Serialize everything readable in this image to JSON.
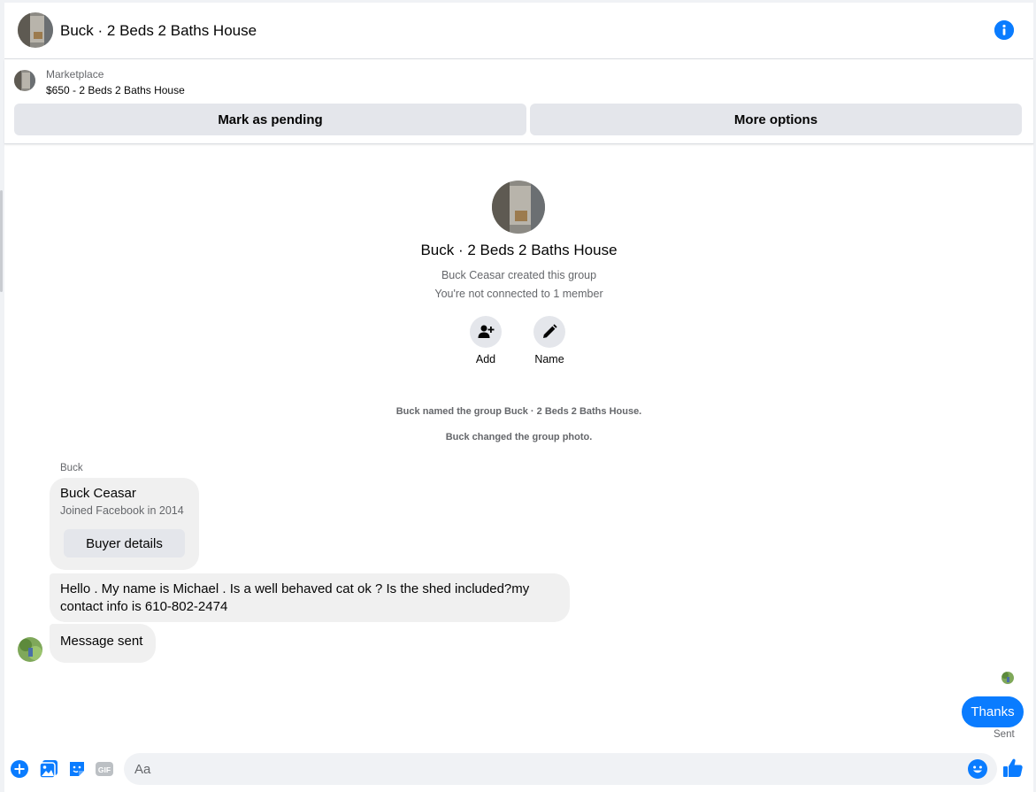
{
  "header": {
    "title": "Buck · 2 Beds 2 Baths House",
    "info_icon": "info-icon"
  },
  "marketplace": {
    "label": "Marketplace",
    "listing": "$650 - 2 Beds 2 Baths House",
    "pending_button": "Mark as pending",
    "more_button": "More options"
  },
  "group": {
    "title": "Buck · 2 Beds 2 Baths House",
    "created_by": "Buck Ceasar created this group",
    "connection": "You're not connected to 1 member",
    "actions": [
      {
        "label": "Add",
        "icon": "add-person-icon"
      },
      {
        "label": "Name",
        "icon": "pencil-icon"
      }
    ]
  },
  "system_messages": [
    "Buck named the group Buck · 2 Beds 2 Baths House.",
    "Buck changed the group photo."
  ],
  "conversation": {
    "sender_name": "Buck",
    "profile_card": {
      "name": "Buck Ceasar",
      "joined": "Joined Facebook in 2014",
      "button": "Buyer details"
    },
    "messages": [
      {
        "text": "Hello . My name is Michael . Is a well behaved cat ok ? Is the shed included?my contact info is 610-802-2474"
      },
      {
        "text": "Message sent"
      }
    ],
    "outgoing": {
      "text": "Thanks",
      "status": "Sent"
    }
  },
  "composer": {
    "placeholder": "Aa",
    "icons": [
      "plus-icon",
      "photo-icon",
      "sticker-icon",
      "gif-icon",
      "emoji-icon",
      "like-icon"
    ],
    "gif_label": "GIF"
  },
  "colors": {
    "accent": "#0a7cff",
    "bubble_gray": "#f0f0f0",
    "button_gray": "#e4e6eb",
    "secondary_text": "#65676b"
  }
}
